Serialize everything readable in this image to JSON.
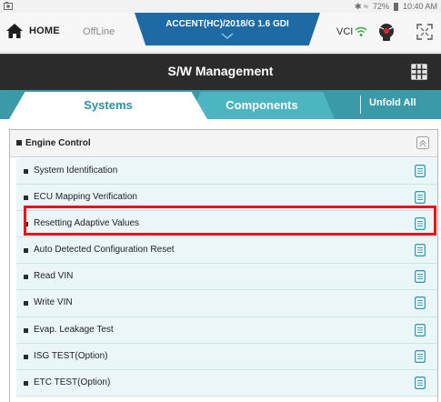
{
  "status_bar": {
    "signal": "✱ ≈",
    "battery_pct": "72%",
    "time": "10:40 AM"
  },
  "top_bar": {
    "home_label": "HOME",
    "connection": "OffLine",
    "vehicle": "ACCENT(HC)/2018/G 1.6 GDI",
    "vci_label": "VCI",
    "icons": [
      "home-icon",
      "chevron-down-icon",
      "wifi-icon",
      "vci-tool-icon",
      "expand-icon"
    ]
  },
  "header": {
    "title": "S/W Management",
    "menu_icon": "grid-icon"
  },
  "tabs": {
    "systems": "Systems",
    "components": "Components",
    "unfold_all": "Unfold All",
    "active": "Systems"
  },
  "group": {
    "label": "Engine Control",
    "collapse_icon": "collapse-icon"
  },
  "items": [
    {
      "label": "System Identification"
    },
    {
      "label": "ECU Mapping Verification"
    },
    {
      "label": "Resetting Adaptive Values"
    },
    {
      "label": "Auto Detected Configuration Reset"
    },
    {
      "label": "Read VIN"
    },
    {
      "label": "Write VIN"
    },
    {
      "label": "Evap. Leakage Test"
    },
    {
      "label": "ISG TEST(Option)"
    },
    {
      "label": "ETC TEST(Option)"
    }
  ],
  "colors": {
    "vehicle_tab": "#1d6aa5",
    "title_bar": "#2b2b2b",
    "tab_bar": "#3a9aa8",
    "row_bg": "#eaf6f8",
    "doc_icon": "#2f9bb0",
    "highlight": "#e8141c"
  }
}
